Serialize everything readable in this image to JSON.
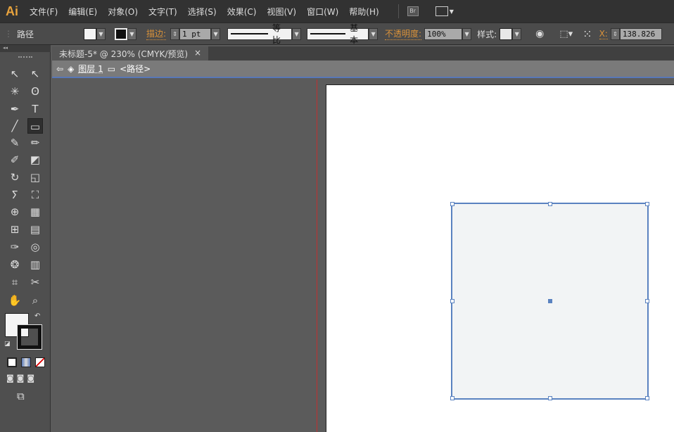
{
  "app": {
    "logo": "Ai",
    "colors": {
      "accent": "#d9923a",
      "selection": "#4a7bc0"
    }
  },
  "menu": [
    "文件(F)",
    "编辑(E)",
    "对象(O)",
    "文字(T)",
    "选择(S)",
    "效果(C)",
    "视图(V)",
    "窗口(W)",
    "帮助(H)"
  ],
  "menu_extra": {
    "bridge": "Br"
  },
  "control": {
    "object_type": "路径",
    "stroke_label": "描边:",
    "stroke_weight": "1 pt",
    "profile": "等比",
    "brush": "基本",
    "opacity_label": "不透明度:",
    "opacity": "100%",
    "style_label": "样式:",
    "x_label": "X:",
    "x_value": "138.826"
  },
  "document": {
    "tab_title": "未标题-5* @ 230% (CMYK/预览)",
    "close": "×",
    "layer": "图层 1",
    "path": "<路径>"
  },
  "tools": [
    [
      "selection-icon",
      "↖"
    ],
    [
      "direct-selection-icon",
      "↖"
    ],
    [
      "magic-wand-icon",
      "✳"
    ],
    [
      "lasso-icon",
      "ʘ"
    ],
    [
      "pen-icon",
      "✒"
    ],
    [
      "type-icon",
      "T"
    ],
    [
      "line-icon",
      "╱"
    ],
    [
      "rectangle-icon",
      "▭"
    ],
    [
      "paintbrush-icon",
      "✎"
    ],
    [
      "pencil-icon",
      "✏"
    ],
    [
      "blob-brush-icon",
      "✐"
    ],
    [
      "eraser-icon",
      "◩"
    ],
    [
      "rotate-icon",
      "↻"
    ],
    [
      "scale-icon",
      "◱"
    ],
    [
      "warp-icon",
      "ⵢ"
    ],
    [
      "free-transform-icon",
      "⛶"
    ],
    [
      "shape-builder-icon",
      "⊕"
    ],
    [
      "perspective-icon",
      "▦"
    ],
    [
      "mesh-icon",
      "⊞"
    ],
    [
      "gradient-icon",
      "▤"
    ],
    [
      "eyedropper-icon",
      "✑"
    ],
    [
      "blend-icon",
      "◎"
    ],
    [
      "symbol-sprayer-icon",
      "❂"
    ],
    [
      "graph-icon",
      "▥"
    ],
    [
      "artboard-icon",
      "⌗"
    ],
    [
      "slice-icon",
      "✂"
    ],
    [
      "hand-icon",
      "✋"
    ],
    [
      "zoom-icon",
      "⌕"
    ]
  ]
}
